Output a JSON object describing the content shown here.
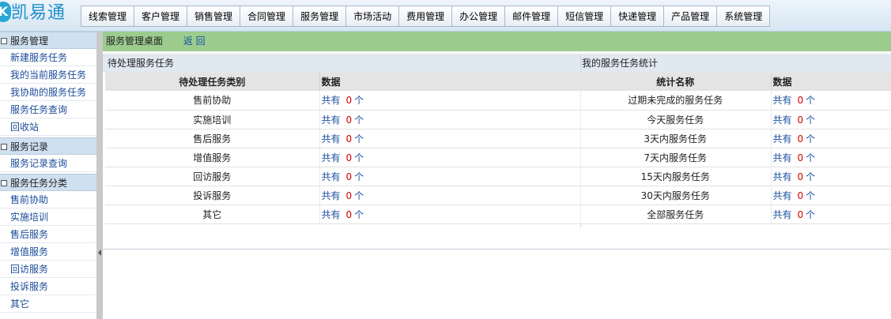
{
  "logo": {
    "mark": "K",
    "text": "凯易通"
  },
  "nav": [
    "线索管理",
    "客户管理",
    "销售管理",
    "合同管理",
    "服务管理",
    "市场活动",
    "费用管理",
    "办公管理",
    "邮件管理",
    "短信管理",
    "快递管理",
    "产品管理",
    "系统管理"
  ],
  "sidebar": {
    "groups": [
      {
        "title": "服务管理",
        "items": [
          "新建服务任务",
          "我的当前服务任务",
          "我协助的服务任务",
          "服务任务查询",
          "回收站"
        ]
      },
      {
        "title": "服务记录",
        "items": [
          "服务记录查询"
        ]
      },
      {
        "title": "服务任务分类",
        "items": [
          "售前协助",
          "实施培训",
          "售后服务",
          "增值服务",
          "回访服务",
          "投诉服务",
          "其它"
        ]
      }
    ]
  },
  "breadcrumb": {
    "title": "服务管理桌面",
    "back": "返 回"
  },
  "pending": {
    "panel_title": "待处理服务任务",
    "col_category": "待处理任务类别",
    "col_data": "数据",
    "rows": [
      {
        "label": "售前协助",
        "prefix": "共有",
        "count": "0",
        "unit": "个"
      },
      {
        "label": "实施培训",
        "prefix": "共有",
        "count": "0",
        "unit": "个"
      },
      {
        "label": "售后服务",
        "prefix": "共有",
        "count": "0",
        "unit": "个"
      },
      {
        "label": "增值服务",
        "prefix": "共有",
        "count": "0",
        "unit": "个"
      },
      {
        "label": "回访服务",
        "prefix": "共有",
        "count": "0",
        "unit": "个"
      },
      {
        "label": "投诉服务",
        "prefix": "共有",
        "count": "0",
        "unit": "个"
      },
      {
        "label": "其它",
        "prefix": "共有",
        "count": "0",
        "unit": "个"
      }
    ]
  },
  "stats": {
    "panel_title": "我的服务任务统计",
    "col_name": "统计名称",
    "col_data": "数据",
    "rows": [
      {
        "label": "过期未完成的服务任务",
        "prefix": "共有",
        "count": "0",
        "unit": "个"
      },
      {
        "label": "今天服务任务",
        "prefix": "共有",
        "count": "0",
        "unit": "个"
      },
      {
        "label": "3天内服务任务",
        "prefix": "共有",
        "count": "0",
        "unit": "个"
      },
      {
        "label": "7天内服务任务",
        "prefix": "共有",
        "count": "0",
        "unit": "个"
      },
      {
        "label": "15天内服务任务",
        "prefix": "共有",
        "count": "0",
        "unit": "个"
      },
      {
        "label": "30天内服务任务",
        "prefix": "共有",
        "count": "0",
        "unit": "个"
      },
      {
        "label": "全部服务任务",
        "prefix": "共有",
        "count": "0",
        "unit": "个"
      }
    ]
  },
  "colors": {
    "link": "#1a4fa0",
    "count": "#d40000",
    "breadcrumb_bg": "#9bcc8e",
    "sidebar_head_bg": "#cfe0f0"
  }
}
